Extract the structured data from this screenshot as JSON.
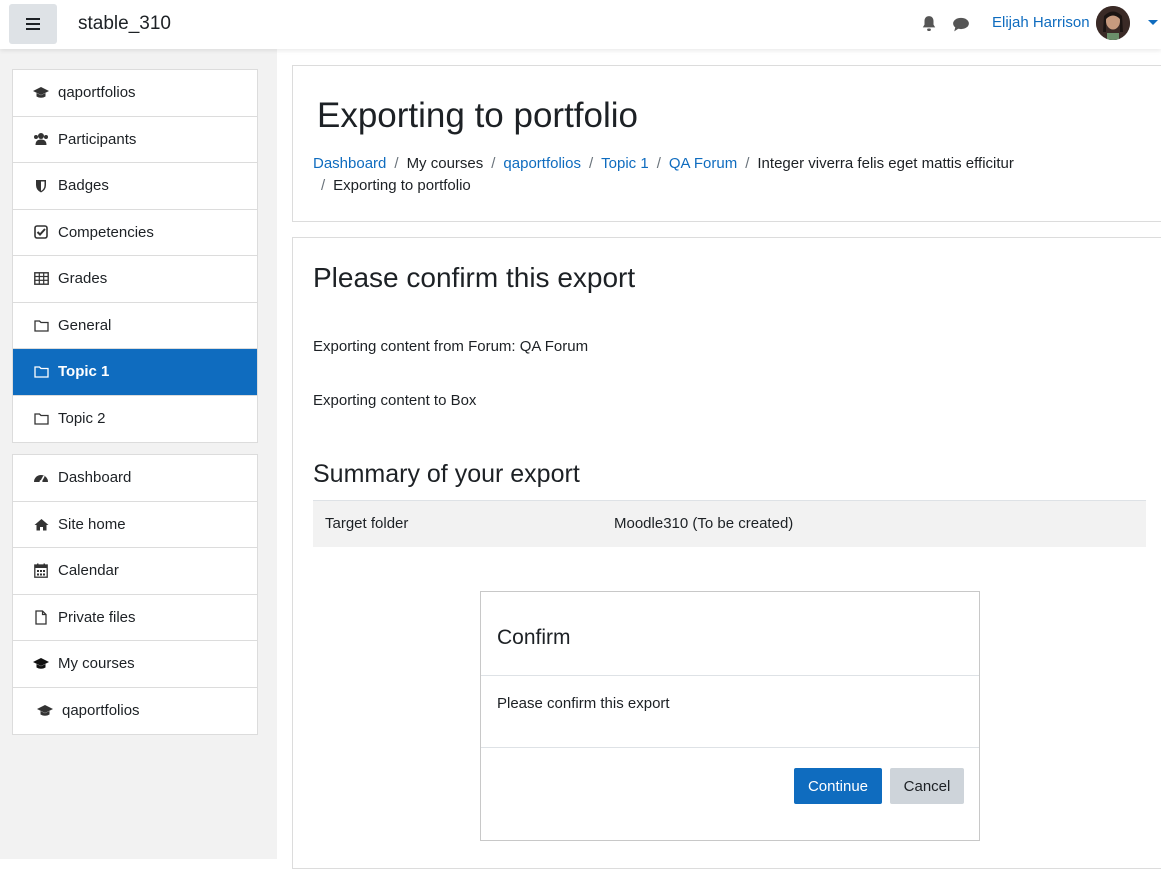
{
  "navbar": {
    "site_name": "stable_310",
    "user_name": "Elijah Harrison"
  },
  "sidebar": {
    "course_items": [
      {
        "label": "qaportfolios",
        "icon": "graduation-cap-icon"
      },
      {
        "label": "Participants",
        "icon": "users-icon"
      },
      {
        "label": "Badges",
        "icon": "shield-icon"
      },
      {
        "label": "Competencies",
        "icon": "check-square-icon"
      },
      {
        "label": "Grades",
        "icon": "table-icon"
      },
      {
        "label": "General",
        "icon": "folder-icon"
      },
      {
        "label": "Topic 1",
        "icon": "folder-icon",
        "active": true
      },
      {
        "label": "Topic 2",
        "icon": "folder-icon"
      }
    ],
    "site_items": [
      {
        "label": "Dashboard",
        "icon": "dashboard-icon"
      },
      {
        "label": "Site home",
        "icon": "home-icon"
      },
      {
        "label": "Calendar",
        "icon": "calendar-icon"
      },
      {
        "label": "Private files",
        "icon": "file-icon"
      },
      {
        "label": "My courses",
        "icon": "graduation-cap-icon"
      },
      {
        "label": "qaportfolios",
        "icon": "graduation-cap-icon"
      }
    ]
  },
  "header": {
    "title": "Exporting to portfolio",
    "breadcrumb": [
      "Dashboard",
      "My courses",
      "qaportfolios",
      "Topic 1",
      "QA Forum",
      "Integer viverra felis eget mattis efficitur",
      "Exporting to portfolio"
    ]
  },
  "main": {
    "confirm_title": "Please confirm this export",
    "line1": "Exporting content from Forum: QA Forum",
    "line2": "Exporting content to Box",
    "summary_title": "Summary of your export",
    "summary_key": "Target folder",
    "summary_value": "Moodle310 (To be created)"
  },
  "modal": {
    "title": "Confirm",
    "body": "Please confirm this export",
    "continue_label": "Continue",
    "cancel_label": "Cancel"
  },
  "colors": {
    "accent": "#0f6cbf",
    "drawer_bg": "#f2f2f2"
  }
}
